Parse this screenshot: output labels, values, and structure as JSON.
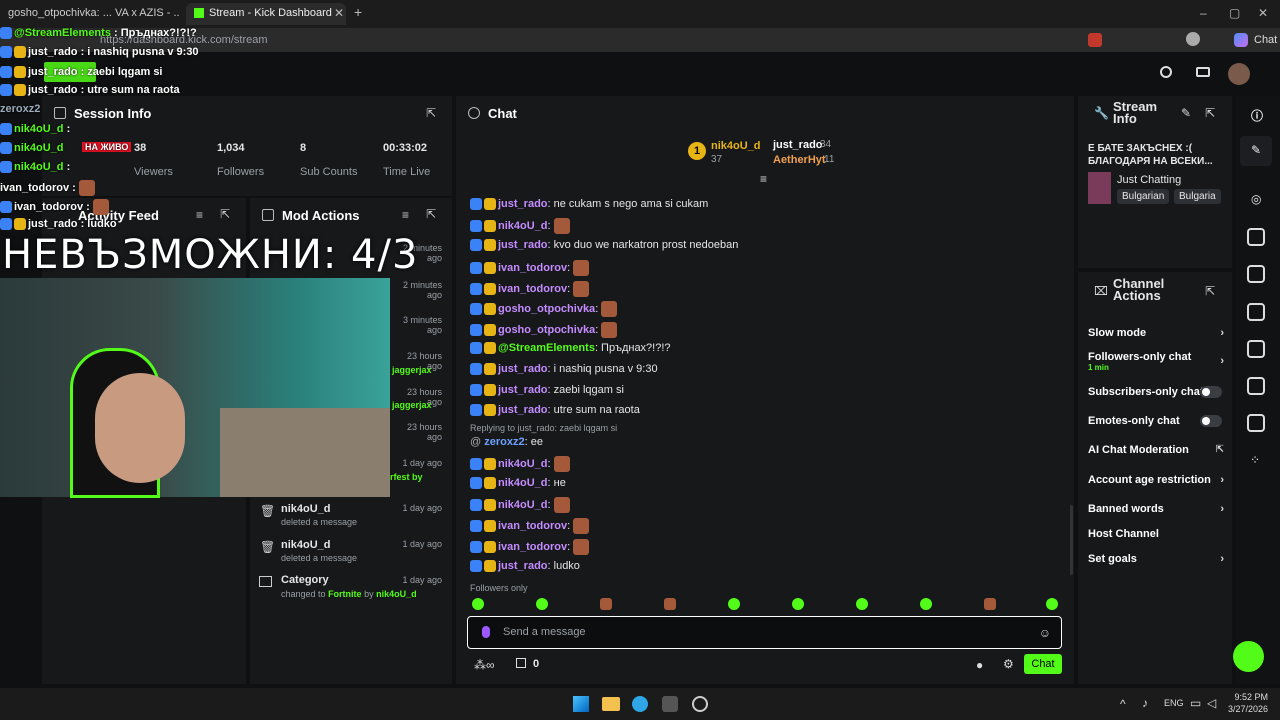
{
  "browser": {
    "tabs": [
      {
        "label": "gosho_otpochivka: ... VA x AZIS - ...",
        "active": false
      },
      {
        "label": "Stream - Kick Dashboard",
        "active": true
      }
    ],
    "url": "https://dashboard.kick.com/stream",
    "profile_label": "Chat"
  },
  "overlay": {
    "chat": [
      {
        "user": "@StreamElements",
        "text": "Пръднах?!?!?"
      },
      {
        "user": "just_rado",
        "text": "i nashiq pusna v 9:30"
      },
      {
        "user": "just_rado",
        "text": "zaebi lqgam si"
      },
      {
        "user": "just_rado",
        "text": "utre sum na raota"
      },
      {
        "user": "zeroxz2",
        "text": "ee"
      },
      {
        "user": "nik4oU_d",
        "text": ""
      },
      {
        "user": "nik4oU_d",
        "text": "не"
      },
      {
        "user": "nik4oU_d",
        "text": ""
      },
      {
        "user": "ivan_todorov",
        "text": ""
      },
      {
        "user": "ivan_todorov",
        "text": ""
      },
      {
        "user": "just_rado",
        "text": "ludko"
      }
    ],
    "big_text": "НЕВЪЗМОЖНИ: 4/3",
    "live_label": "НА ЖИВО"
  },
  "session": {
    "title": "Session Info",
    "stats": [
      {
        "value": "38",
        "label": "Viewers"
      },
      {
        "value": "1,034",
        "label": "Followers"
      },
      {
        "value": "8",
        "label": "Sub Counts"
      },
      {
        "value": "00:33:02",
        "label": "Time Live"
      }
    ]
  },
  "activity": {
    "title": "Activity Feed"
  },
  "mod": {
    "title": "Mod Actions",
    "times": [
      "2 minutes ago",
      "2 minutes ago",
      "3 minutes ago",
      "23 hours ago",
      "23 hours ago",
      "23 hours ago",
      "1 day ago"
    ],
    "partial": [
      "jaggerjax",
      "jaggerjax",
      "rfest by"
    ],
    "items": [
      {
        "user": "nik4oU_d",
        "action": "deleted a message",
        "time": "1 day ago"
      },
      {
        "user": "nik4oU_d",
        "action": "deleted a message",
        "time": "1 day ago"
      },
      {
        "user": "Category",
        "action": "changed to",
        "target": "Fortnite",
        "by": "by",
        "by_user": "nik4oU_d",
        "time": "1 day ago"
      }
    ]
  },
  "chat": {
    "title": "Chat",
    "top": [
      {
        "rank": "1",
        "user": "nik4oU_d",
        "count": "37"
      },
      {
        "rank": "",
        "user": "just_rado",
        "count": "34"
      },
      {
        "rank": "",
        "user": "AetherHyt",
        "count": "11"
      }
    ],
    "messages": [
      {
        "user": "just_rado",
        "text": ": ne cukam s nego ama si cukam",
        "color": "#c48cff"
      },
      {
        "user": "nik4oU_d",
        "text": ":",
        "color": "#c48cff",
        "emote": true
      },
      {
        "user": "just_rado",
        "text": ": kvo duo we narkatron prost nedoeban",
        "color": "#c48cff"
      },
      {
        "user": "ivan_todorov",
        "text": ":",
        "color": "#c48cff",
        "emote": true
      },
      {
        "user": "ivan_todorov",
        "text": ":",
        "color": "#c48cff",
        "emote": true
      },
      {
        "user": "gosho_otpochivka",
        "text": ":",
        "color": "#c48cff",
        "emote": true
      },
      {
        "user": "gosho_otpochivka",
        "text": ":",
        "color": "#c48cff",
        "emote": true
      },
      {
        "user": "@StreamElements",
        "text": ": Пръднах?!?!?",
        "color": "#53fc18"
      },
      {
        "user": "just_rado",
        "text": ": i nashiq pusna v 9:30",
        "color": "#c48cff"
      },
      {
        "user": "just_rado",
        "text": ": zaebi lqgam si",
        "color": "#c48cff"
      },
      {
        "user": "just_rado",
        "text": ": utre sum na raota",
        "color": "#c48cff"
      }
    ],
    "reply_hint": "Replying to just_rado: zaebi lqgam si",
    "reply": {
      "user": "zeroxz2",
      "text": ": ee"
    },
    "messages2": [
      {
        "user": "nik4oU_d",
        "text": ":",
        "emote": true
      },
      {
        "user": "nik4oU_d",
        "text": ": не",
        "emote": false
      },
      {
        "user": "nik4oU_d",
        "text": ":",
        "emote": true
      },
      {
        "user": "ivan_todorov",
        "text": ":",
        "emote": true
      },
      {
        "user": "ivan_todorov",
        "text": ":",
        "emote": true
      },
      {
        "user": "just_rado",
        "text": ": ludko",
        "emote": false
      }
    ],
    "followers_only": "Followers only",
    "placeholder": "Send a message",
    "points": "0",
    "send_label": "Chat"
  },
  "stream_info": {
    "title": "Stream Info",
    "stream_title": "Е БАТЕ ЗАКЪСНЕХ :( БЛАГОДАРЯ НА ВСЕКИ...",
    "category": "Just Chatting",
    "tags": [
      "Bulgarian",
      "Bulgaria"
    ]
  },
  "channel_actions": {
    "title": "Channel Actions",
    "items": [
      {
        "label": "Slow mode",
        "kind": "chevron"
      },
      {
        "label": "Followers-only chat",
        "sub": "1 min",
        "kind": "chevron"
      },
      {
        "label": "Subscribers-only chat",
        "kind": "toggle"
      },
      {
        "label": "Emotes-only chat",
        "kind": "toggle"
      },
      {
        "label": "AI Chat Moderation",
        "kind": "external"
      },
      {
        "label": "Account age restriction",
        "kind": "chevron"
      },
      {
        "label": "Banned words",
        "kind": "chevron"
      },
      {
        "label": "Host Channel",
        "kind": "none"
      },
      {
        "label": "Set goals",
        "kind": "chevron"
      }
    ]
  },
  "taskbar": {
    "lang": "ENG",
    "time": "9:52 PM",
    "date": "3/27/2026"
  }
}
